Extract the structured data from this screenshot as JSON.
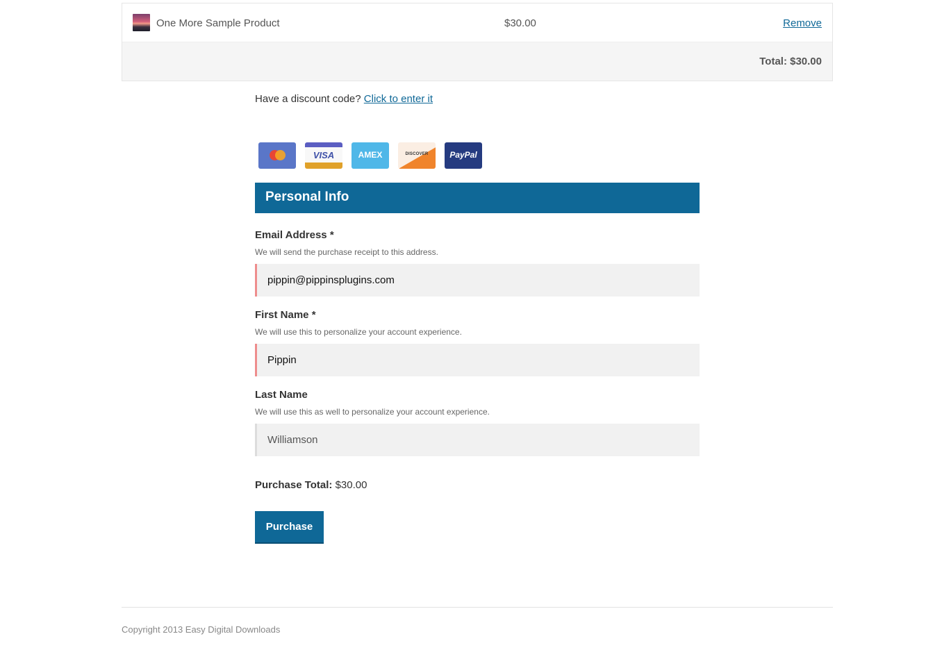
{
  "cart": {
    "items": [
      {
        "name": "One More Sample Product",
        "price": "$30.00",
        "remove_label": "Remove"
      }
    ],
    "total_label": "Total: $30.00"
  },
  "discount": {
    "prompt": "Have a discount code?",
    "link": "Click to enter it"
  },
  "payment_icons": [
    "mastercard-icon",
    "visa-icon",
    "amex-icon",
    "discover-icon",
    "paypal-icon"
  ],
  "payment_icon_text": {
    "visa": "VISA",
    "amex": "AMEX",
    "discover": "DISCOVER",
    "paypal": "PayPal"
  },
  "personal_info": {
    "heading": "Personal Info",
    "email": {
      "label": "Email Address *",
      "description": "We will send the purchase receipt to this address.",
      "value": "pippin@pippinsplugins.com"
    },
    "first_name": {
      "label": "First Name *",
      "description": "We will use this to personalize your account experience.",
      "value": "Pippin"
    },
    "last_name": {
      "label": "Last Name",
      "description": "We will use this as well to personalize your account experience.",
      "value": "Williamson"
    }
  },
  "purchase": {
    "total_label": "Purchase Total:",
    "total_value": "$30.00",
    "button_label": "Purchase"
  },
  "footer": {
    "copyright": "Copyright 2013 Easy Digital Downloads"
  },
  "colors": {
    "accent": "#0f6897",
    "required_border": "#ee8d8d",
    "panel_bg": "#f5f5f5"
  }
}
